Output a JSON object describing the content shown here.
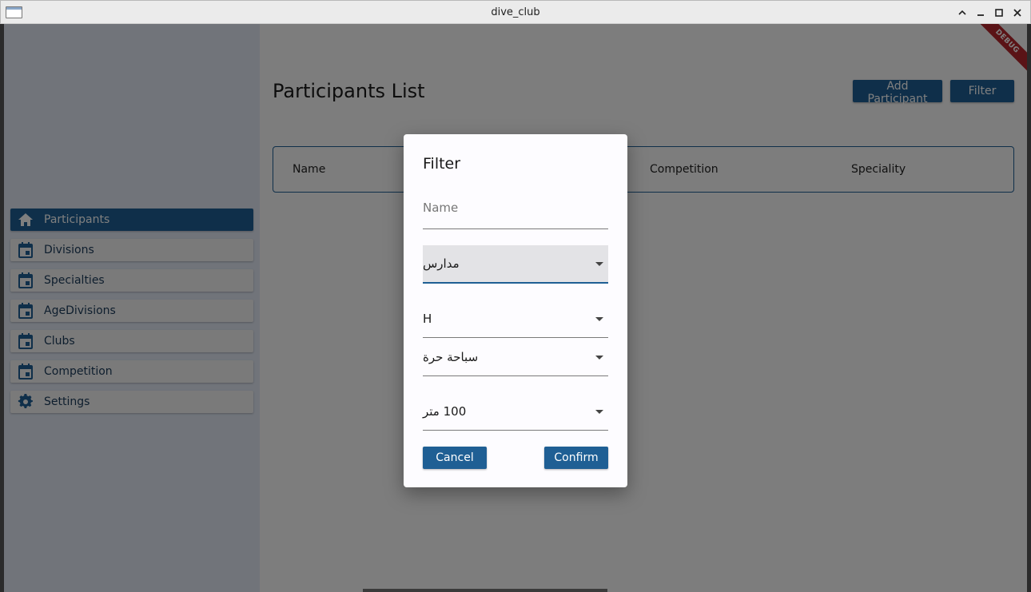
{
  "window": {
    "title": "dive_club"
  },
  "sidebar": {
    "items": [
      {
        "label": "Participants",
        "icon": "home-icon",
        "active": true
      },
      {
        "label": "Divisions",
        "icon": "calendar-icon"
      },
      {
        "label": "Specialties",
        "icon": "calendar-icon"
      },
      {
        "label": "AgeDivisions",
        "icon": "calendar-icon"
      },
      {
        "label": "Clubs",
        "icon": "calendar-icon"
      },
      {
        "label": "Competition",
        "icon": "calendar-icon"
      },
      {
        "label": "Settings",
        "icon": "gear-icon"
      }
    ]
  },
  "main": {
    "title": "Participants List",
    "add_label": "Add Participant",
    "filter_label": "Filter",
    "table_headers": [
      "Name",
      "Competition",
      "Speciality"
    ],
    "debug": "DEBUG"
  },
  "dialog": {
    "title": "Filter",
    "name_placeholder": "Name",
    "category_value": "مدارس",
    "gender_value": "H",
    "style_value": "سباحة حرة",
    "distance_value": "100 متر",
    "cancel_label": "Cancel",
    "confirm_label": "Confirm"
  },
  "colors": {
    "primary": "#1f5f94",
    "sidebar_bg": "#e2e9f5",
    "debug_red": "#b5262d"
  }
}
